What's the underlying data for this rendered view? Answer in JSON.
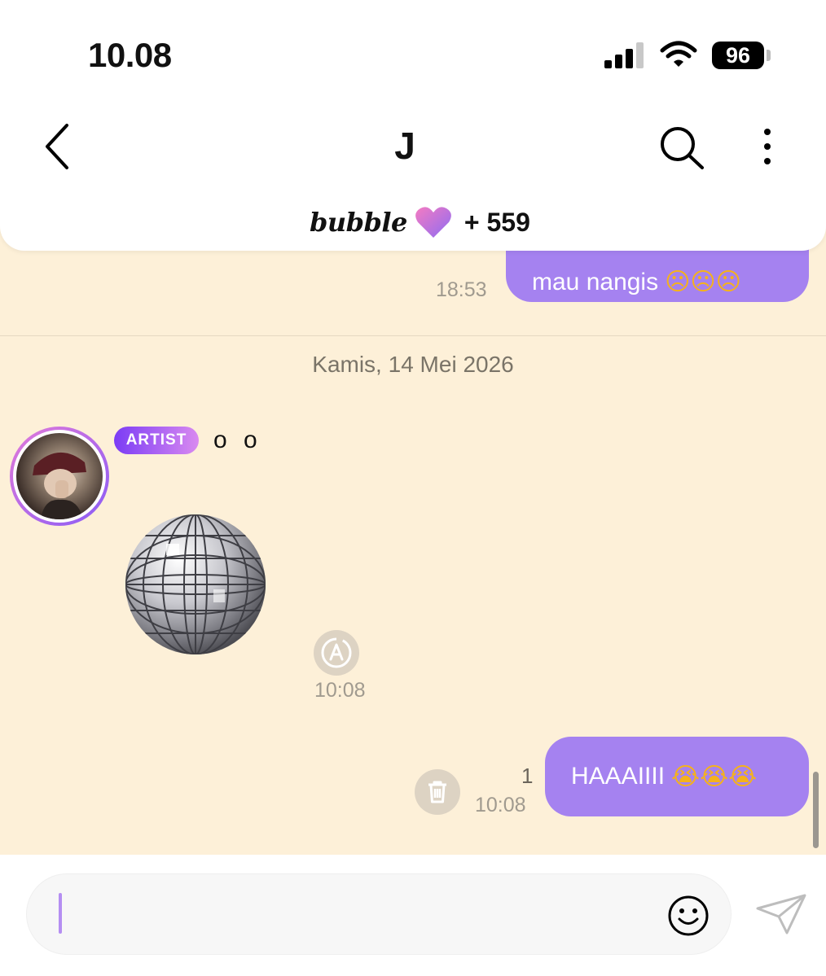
{
  "status_bar": {
    "time": "10.08",
    "battery": "96"
  },
  "header": {
    "title": "J",
    "brand": "bubble",
    "brand_count": "+ 559"
  },
  "messages": {
    "out_1": {
      "text": "mau nangis",
      "emoji": "☹☹☹",
      "time": "18:53"
    },
    "date_divider": "Kamis, 14 Mei 2026",
    "artist": {
      "badge": "ARTIST",
      "name": "o o",
      "sticker": "disco-ball",
      "time": "10:08"
    },
    "out_2": {
      "text": "HAAAIIII",
      "emoji": "😭😭😭",
      "time": "10:08",
      "unread": "1"
    }
  },
  "composer": {
    "value": "",
    "placeholder": ""
  },
  "colors": {
    "bubble_out": "#a582f0",
    "background": "#fdf0d8",
    "badge_start": "#7b3cf5",
    "badge_end": "#d98af0"
  }
}
